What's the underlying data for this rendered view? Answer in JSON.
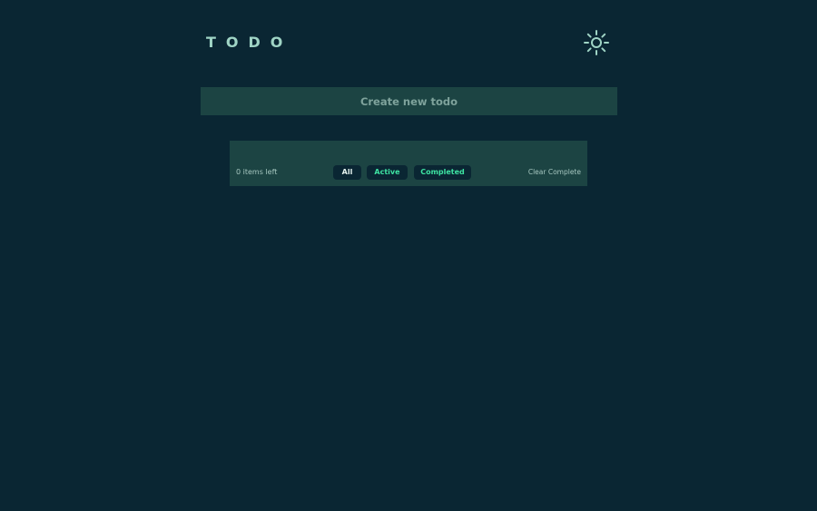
{
  "header": {
    "title": "TODO",
    "theme_toggle_icon": "sun-icon"
  },
  "new_todo": {
    "placeholder": "Create new todo",
    "value": ""
  },
  "todos": [],
  "footer": {
    "items_left": "0 items left",
    "filters": [
      {
        "label": "All",
        "selected": true
      },
      {
        "label": "Active",
        "selected": false
      },
      {
        "label": "Completed",
        "selected": false
      }
    ],
    "clear_label": "Clear Complete"
  },
  "colors": {
    "background": "#0a2633",
    "panel": "#1c4443",
    "title": "#9fd4c5",
    "filter_accent": "#3ee3a2",
    "filter_selected_text": "#e6f3ef",
    "muted_text": "#a6c7c0"
  }
}
